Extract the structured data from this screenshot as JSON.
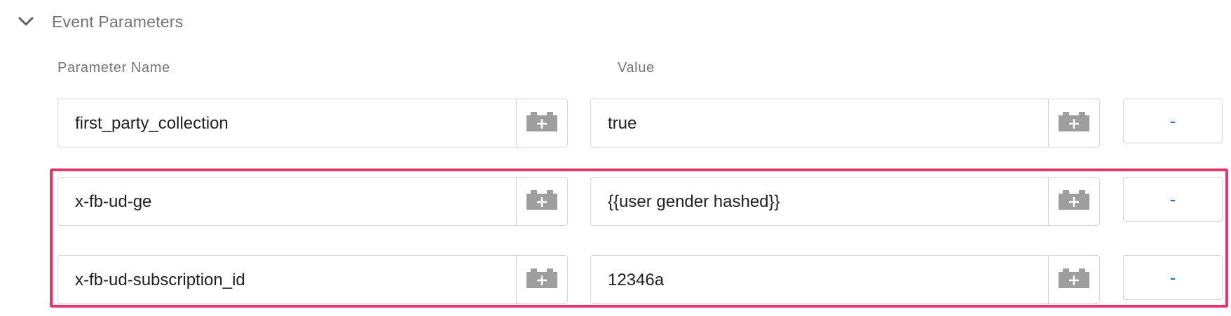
{
  "section": {
    "title": "Event Parameters",
    "toggle_icon": "chevron-down-icon"
  },
  "columns": {
    "name_label": "Parameter Name",
    "value_label": "Value"
  },
  "rows": [
    {
      "name": "first_party_collection",
      "value": "true",
      "remove_label": "-"
    },
    {
      "name": "x-fb-ud-ge",
      "value": "{{user gender hashed}}",
      "remove_label": "-"
    },
    {
      "name": "x-fb-ud-subscription_id",
      "value": "12346a",
      "remove_label": "-"
    }
  ],
  "icons": {
    "variable_picker": "add-variable-brick-icon"
  },
  "colors": {
    "highlight": "#e8336d",
    "remove_button": "#1a73e8",
    "label_gray": "#757575",
    "icon_gray": "#9e9e9e"
  }
}
